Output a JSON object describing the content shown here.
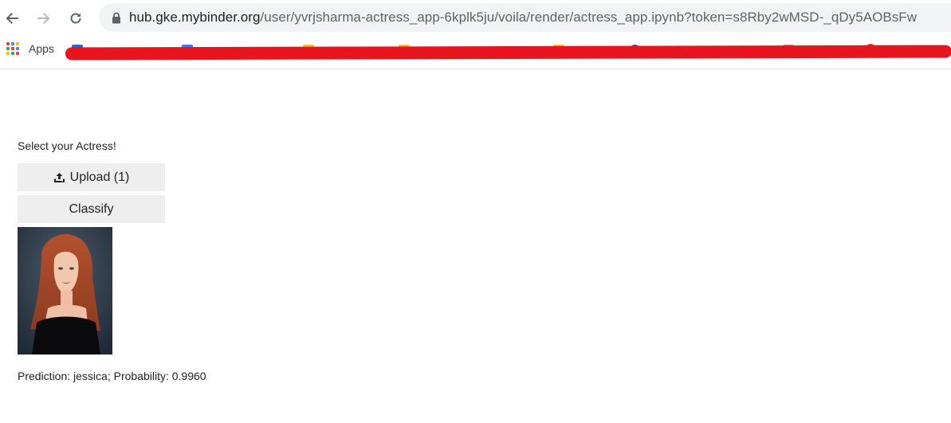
{
  "browser": {
    "url_host": "hub.gke.mybinder.org",
    "url_path": "/user/yvrjsharma-actress_app-6kplk5ju/voila/render/actress_app.ipynb?token=s8Rby2wMSD-_qDy5AOBsFw"
  },
  "bookmarks": {
    "apps_label": "Apps",
    "app_grid_colors": [
      "#ea4335",
      "#4285f4",
      "#fbbc05",
      "#34a853",
      "#ea4335",
      "#4285f4",
      "#fbbc05",
      "#34a853",
      "#ea4335"
    ]
  },
  "app": {
    "prompt": "Select your Actress!",
    "upload_label": "Upload (1)",
    "classify_label": "Classify",
    "prediction_text": "Prediction: jessica; Probability: 0.9960"
  },
  "colors": {
    "redaction": "#e8141e",
    "button_bg": "#eeeeee"
  }
}
